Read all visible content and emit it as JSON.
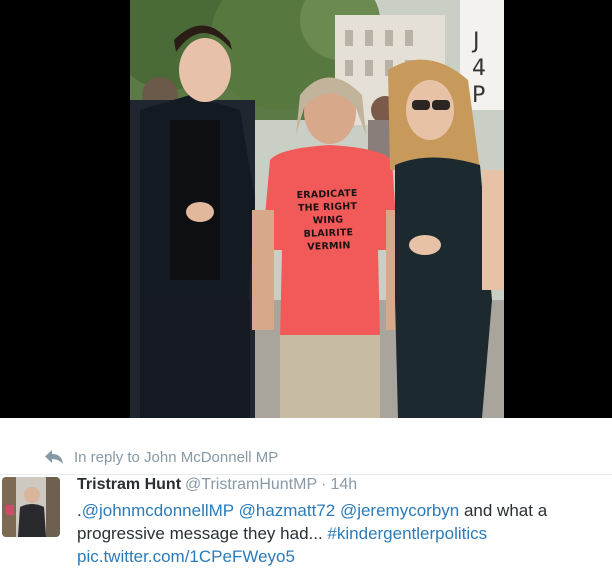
{
  "photo": {
    "shirt_lines": [
      "ERADICATE",
      "THE RIGHT WING",
      "BLAIRITE",
      "VERMIN"
    ],
    "sign_letters": "J4P"
  },
  "reply": {
    "text": "In reply to John McDonnell MP"
  },
  "tweet": {
    "author_name": "Tristram Hunt",
    "author_handle": "@TristramHuntMP",
    "separator": "·",
    "time": "14h",
    "text_prefix": ".",
    "mention_1": "@johnmcdonnellMP",
    "mention_2": "@hazmatt72",
    "mention_3": "@jeremycorbyn",
    "text_middle": "and what a progressive message they had...",
    "hashtag": "#kindergentlerpolitics",
    "link": "pic.twitter.com/1CPeFWeyo5"
  },
  "colors": {
    "link": "#2b7bb9",
    "muted": "#8899a6",
    "text": "#292f33",
    "shirt": "#f25a5a"
  },
  "icons": {
    "reply": "reply-arrow-icon"
  }
}
